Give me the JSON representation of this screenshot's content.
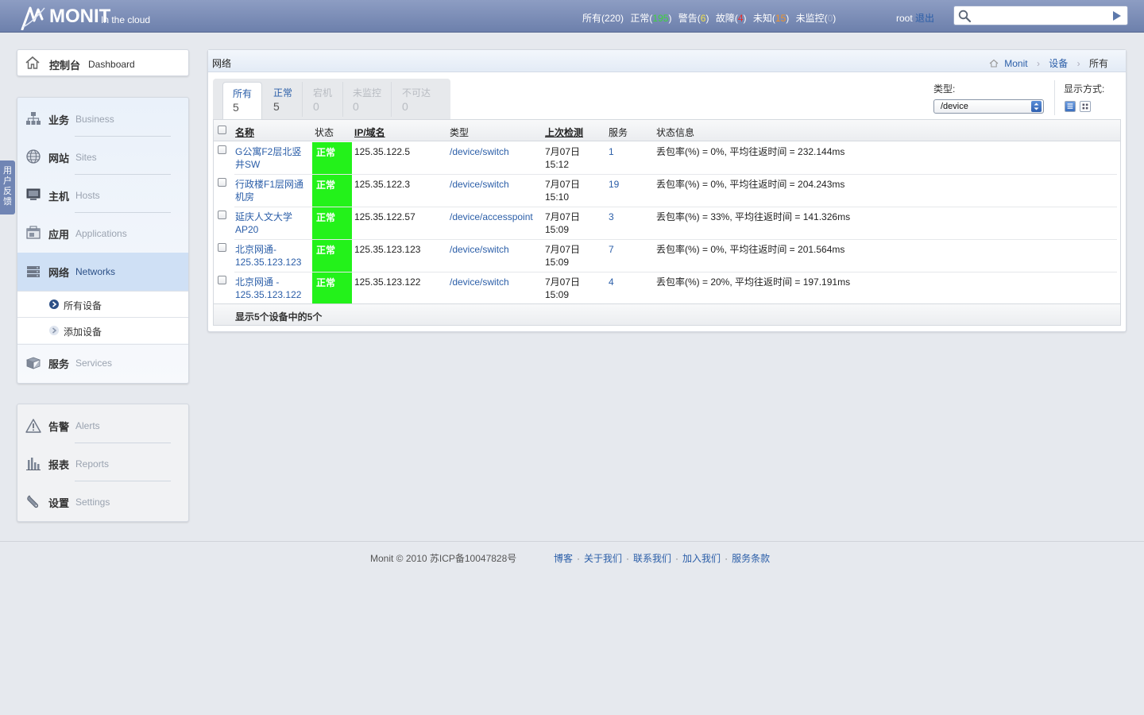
{
  "header": {
    "logo_text": "MONIT",
    "logo_sub": "In the cloud",
    "summary": {
      "all_label": "所有",
      "all_count": "220",
      "normal_label": "正常",
      "normal_count": "195",
      "warn_label": "警告",
      "warn_count": "6",
      "fault_label": "故障",
      "fault_count": "4",
      "unknown_label": "未知",
      "unknown_count": "15",
      "unmonitored_label": "未监控",
      "unmonitored_count": "0"
    },
    "user": "root",
    "logout": "退出",
    "search_value": ""
  },
  "feedback_chars": [
    "用",
    "户",
    "反",
    "馈"
  ],
  "sidebar": {
    "dashboard": {
      "zh": "控制台",
      "en": "Dashboard"
    },
    "groups": [
      {
        "zh": "业务",
        "en": "Business",
        "icon": "business-icon"
      },
      {
        "zh": "网站",
        "en": "Sites",
        "icon": "globe-icon"
      },
      {
        "zh": "主机",
        "en": "Hosts",
        "icon": "monitor-icon"
      },
      {
        "zh": "应用",
        "en": "Applications",
        "icon": "app-icon"
      },
      {
        "zh": "网络",
        "en": "Networks",
        "icon": "network-icon"
      }
    ],
    "sub_items": [
      "所有设备",
      "添加设备"
    ],
    "services": {
      "zh": "服务",
      "en": "Services"
    },
    "system": [
      {
        "zh": "告警",
        "en": "Alerts",
        "icon": "warning-icon"
      },
      {
        "zh": "报表",
        "en": "Reports",
        "icon": "bar-chart-icon"
      },
      {
        "zh": "设置",
        "en": "Settings",
        "icon": "wrench-icon"
      }
    ]
  },
  "main": {
    "title": "网络",
    "breadcrumb": [
      "Monit",
      "设备",
      "所有"
    ],
    "tabs": [
      {
        "label": "所有",
        "count": "5"
      },
      {
        "label": "正常",
        "count": "5"
      },
      {
        "label": "宕机",
        "count": "0"
      },
      {
        "label": "未监控",
        "count": "0"
      },
      {
        "label": "不可达",
        "count": "0"
      }
    ],
    "type_label": "类型:",
    "type_value": "/device",
    "view_label": "显示方式:",
    "columns": [
      "名称",
      "状态",
      "IP/域名",
      "类型",
      "上次检测",
      "服务",
      "状态信息"
    ],
    "rows": [
      {
        "name1": "G公寓F2层北竖",
        "name2": "井SW",
        "status": "正常",
        "ip": "125.35.122.5",
        "type_root": "/device/",
        "type_leaf": "switch",
        "date": "7月07日",
        "time": "15:12",
        "services": "1",
        "info": "丢包率(%) = 0%, 平均往返时间 = 232.144ms"
      },
      {
        "name1": "行政楼F1层网通",
        "name2": "机房",
        "status": "正常",
        "ip": "125.35.122.3",
        "type_root": "/device/",
        "type_leaf": "switch",
        "date": "7月07日",
        "time": "15:10",
        "services": "19",
        "info": "丢包率(%) = 0%, 平均往返时间 = 204.243ms"
      },
      {
        "name1": "延庆人文大学",
        "name2": "AP20",
        "status": "正常",
        "ip": "125.35.122.57",
        "type_root": "/device/",
        "type_leaf": "accesspoint",
        "date": "7月07日",
        "time": "15:09",
        "services": "3",
        "info": "丢包率(%) = 33%, 平均往返时间 = 141.326ms"
      },
      {
        "name1": "北京网通-",
        "name2": "125.35.123.123",
        "status": "正常",
        "ip": "125.35.123.123",
        "type_root": "/device/",
        "type_leaf": "switch",
        "date": "7月07日",
        "time": "15:09",
        "services": "7",
        "info": "丢包率(%) = 0%, 平均往返时间 = 201.564ms"
      },
      {
        "name1": "北京网通 -",
        "name2": "125.35.123.122",
        "status": "正常",
        "ip": "125.35.123.122",
        "type_root": "/device/",
        "type_leaf": "switch",
        "date": "7月07日",
        "time": "15:09",
        "services": "4",
        "info": "丢包率(%) = 20%, 平均往返时间 = 197.191ms"
      }
    ],
    "footer_text": "显示5个设备中的5个"
  },
  "footer": {
    "copyright": "Monit © 2010 苏ICP备10047828号",
    "links": [
      "博客",
      "关于我们",
      "联系我们",
      "加入我们",
      "服务条款"
    ]
  },
  "colors": {
    "header": "#7a8cb6",
    "status_ok": "#23f21a",
    "link": "#2b5ea8"
  }
}
